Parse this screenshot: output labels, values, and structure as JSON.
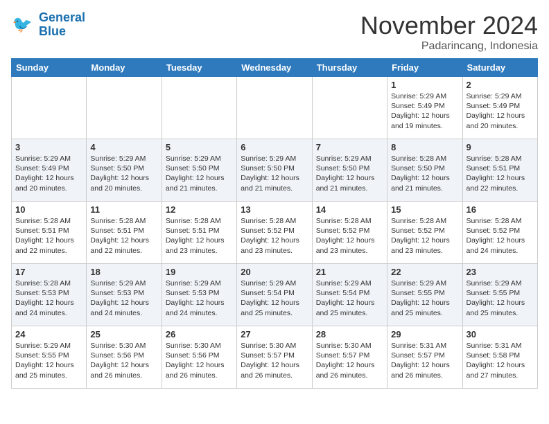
{
  "header": {
    "logo_line1": "General",
    "logo_line2": "Blue",
    "month_title": "November 2024",
    "location": "Padarincang, Indonesia"
  },
  "weekdays": [
    "Sunday",
    "Monday",
    "Tuesday",
    "Wednesday",
    "Thursday",
    "Friday",
    "Saturday"
  ],
  "weeks": [
    [
      {
        "day": "",
        "info": ""
      },
      {
        "day": "",
        "info": ""
      },
      {
        "day": "",
        "info": ""
      },
      {
        "day": "",
        "info": ""
      },
      {
        "day": "",
        "info": ""
      },
      {
        "day": "1",
        "info": "Sunrise: 5:29 AM\nSunset: 5:49 PM\nDaylight: 12 hours and 19 minutes."
      },
      {
        "day": "2",
        "info": "Sunrise: 5:29 AM\nSunset: 5:49 PM\nDaylight: 12 hours and 20 minutes."
      }
    ],
    [
      {
        "day": "3",
        "info": "Sunrise: 5:29 AM\nSunset: 5:49 PM\nDaylight: 12 hours and 20 minutes."
      },
      {
        "day": "4",
        "info": "Sunrise: 5:29 AM\nSunset: 5:50 PM\nDaylight: 12 hours and 20 minutes."
      },
      {
        "day": "5",
        "info": "Sunrise: 5:29 AM\nSunset: 5:50 PM\nDaylight: 12 hours and 21 minutes."
      },
      {
        "day": "6",
        "info": "Sunrise: 5:29 AM\nSunset: 5:50 PM\nDaylight: 12 hours and 21 minutes."
      },
      {
        "day": "7",
        "info": "Sunrise: 5:29 AM\nSunset: 5:50 PM\nDaylight: 12 hours and 21 minutes."
      },
      {
        "day": "8",
        "info": "Sunrise: 5:28 AM\nSunset: 5:50 PM\nDaylight: 12 hours and 21 minutes."
      },
      {
        "day": "9",
        "info": "Sunrise: 5:28 AM\nSunset: 5:51 PM\nDaylight: 12 hours and 22 minutes."
      }
    ],
    [
      {
        "day": "10",
        "info": "Sunrise: 5:28 AM\nSunset: 5:51 PM\nDaylight: 12 hours and 22 minutes."
      },
      {
        "day": "11",
        "info": "Sunrise: 5:28 AM\nSunset: 5:51 PM\nDaylight: 12 hours and 22 minutes."
      },
      {
        "day": "12",
        "info": "Sunrise: 5:28 AM\nSunset: 5:51 PM\nDaylight: 12 hours and 23 minutes."
      },
      {
        "day": "13",
        "info": "Sunrise: 5:28 AM\nSunset: 5:52 PM\nDaylight: 12 hours and 23 minutes."
      },
      {
        "day": "14",
        "info": "Sunrise: 5:28 AM\nSunset: 5:52 PM\nDaylight: 12 hours and 23 minutes."
      },
      {
        "day": "15",
        "info": "Sunrise: 5:28 AM\nSunset: 5:52 PM\nDaylight: 12 hours and 23 minutes."
      },
      {
        "day": "16",
        "info": "Sunrise: 5:28 AM\nSunset: 5:52 PM\nDaylight: 12 hours and 24 minutes."
      }
    ],
    [
      {
        "day": "17",
        "info": "Sunrise: 5:28 AM\nSunset: 5:53 PM\nDaylight: 12 hours and 24 minutes."
      },
      {
        "day": "18",
        "info": "Sunrise: 5:29 AM\nSunset: 5:53 PM\nDaylight: 12 hours and 24 minutes."
      },
      {
        "day": "19",
        "info": "Sunrise: 5:29 AM\nSunset: 5:53 PM\nDaylight: 12 hours and 24 minutes."
      },
      {
        "day": "20",
        "info": "Sunrise: 5:29 AM\nSunset: 5:54 PM\nDaylight: 12 hours and 25 minutes."
      },
      {
        "day": "21",
        "info": "Sunrise: 5:29 AM\nSunset: 5:54 PM\nDaylight: 12 hours and 25 minutes."
      },
      {
        "day": "22",
        "info": "Sunrise: 5:29 AM\nSunset: 5:55 PM\nDaylight: 12 hours and 25 minutes."
      },
      {
        "day": "23",
        "info": "Sunrise: 5:29 AM\nSunset: 5:55 PM\nDaylight: 12 hours and 25 minutes."
      }
    ],
    [
      {
        "day": "24",
        "info": "Sunrise: 5:29 AM\nSunset: 5:55 PM\nDaylight: 12 hours and 25 minutes."
      },
      {
        "day": "25",
        "info": "Sunrise: 5:30 AM\nSunset: 5:56 PM\nDaylight: 12 hours and 26 minutes."
      },
      {
        "day": "26",
        "info": "Sunrise: 5:30 AM\nSunset: 5:56 PM\nDaylight: 12 hours and 26 minutes."
      },
      {
        "day": "27",
        "info": "Sunrise: 5:30 AM\nSunset: 5:57 PM\nDaylight: 12 hours and 26 minutes."
      },
      {
        "day": "28",
        "info": "Sunrise: 5:30 AM\nSunset: 5:57 PM\nDaylight: 12 hours and 26 minutes."
      },
      {
        "day": "29",
        "info": "Sunrise: 5:31 AM\nSunset: 5:57 PM\nDaylight: 12 hours and 26 minutes."
      },
      {
        "day": "30",
        "info": "Sunrise: 5:31 AM\nSunset: 5:58 PM\nDaylight: 12 hours and 27 minutes."
      }
    ]
  ]
}
